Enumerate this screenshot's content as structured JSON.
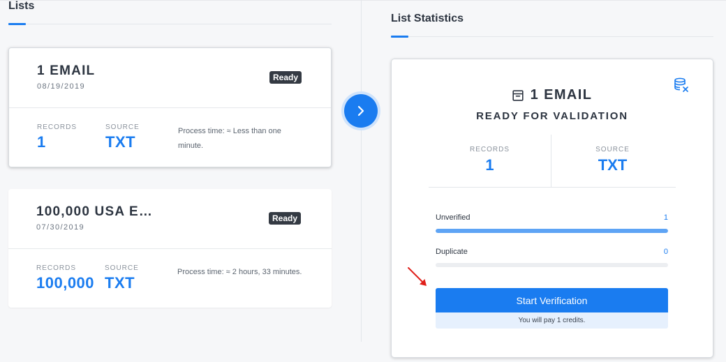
{
  "lists_section": {
    "title": "Lists"
  },
  "stats_section": {
    "title": "List Statistics"
  },
  "lists": [
    {
      "name": "1 EMAIL",
      "date": "08/19/2019",
      "status": "Ready",
      "records_label": "RECORDS",
      "records": "1",
      "source_label": "SOURCE",
      "source": "TXT",
      "process_time": "Process time: ≈ Less than one minute."
    },
    {
      "name": "100,000 USA E…",
      "date": "07/30/2019",
      "status": "Ready",
      "records_label": "RECORDS",
      "records": "100,000",
      "source_label": "SOURCE",
      "source": "TXT",
      "process_time": "Process time: ≈ 2 hours, 33 minutes."
    }
  ],
  "icons": {
    "next": "chevron-right-icon",
    "file": "archive-box-icon",
    "database_remove": "database-x-icon"
  },
  "stats": {
    "title": "1 EMAIL",
    "subtitle": "READY FOR VALIDATION",
    "records_label": "RECORDS",
    "records": "1",
    "source_label": "SOURCE",
    "source": "TXT",
    "unverified_label": "Unverified",
    "unverified_count": "1",
    "unverified_fraction": 1.0,
    "duplicate_label": "Duplicate",
    "duplicate_count": "0",
    "duplicate_fraction": 0.0,
    "start_button": "Start Verification",
    "pay_note": "You will pay 1 credits."
  },
  "colors": {
    "accent": "#1a7cf0",
    "badge": "#343a43",
    "annotation_arrow": "#e0201b"
  }
}
